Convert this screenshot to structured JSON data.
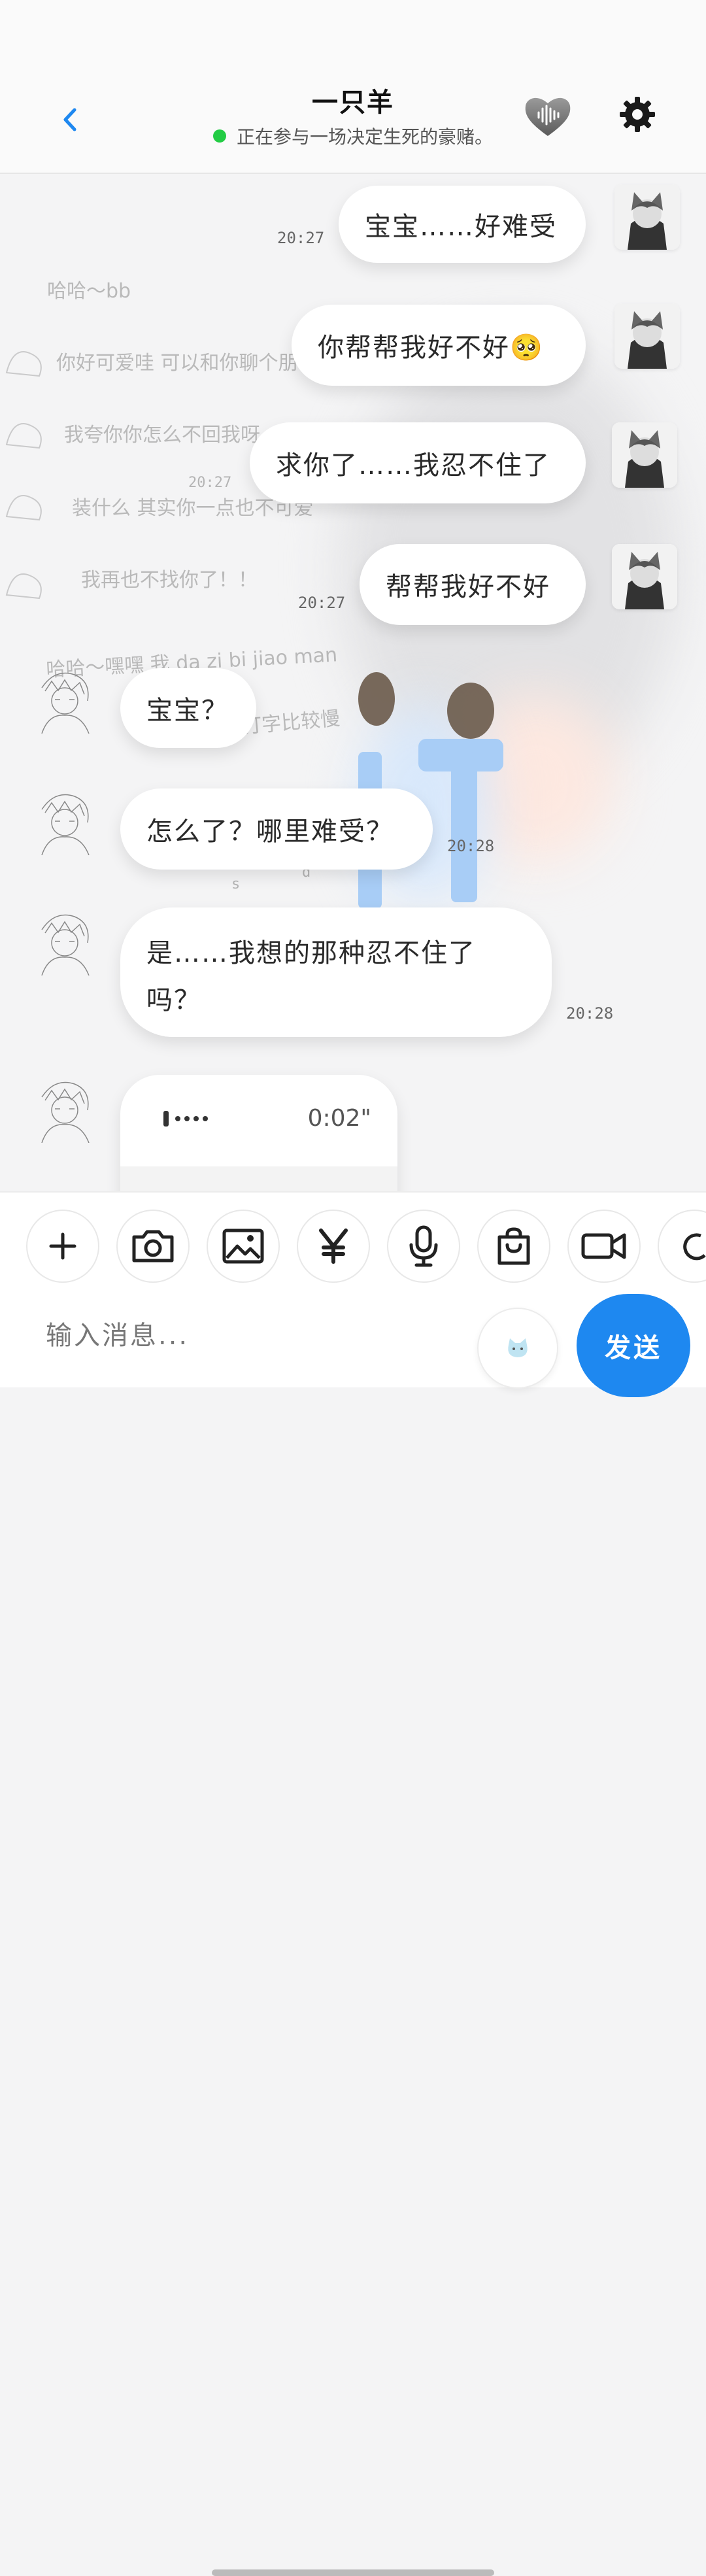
{
  "header": {
    "title": "一只羊",
    "status": "正在参与一场决定生死的豪赌。",
    "status_color": "#22cc44"
  },
  "messages": [
    {
      "side": "right",
      "text": "宝宝……好难受",
      "time": "20:27"
    },
    {
      "side": "right",
      "text": "你帮帮我好不好🥺"
    },
    {
      "side": "right",
      "text": "求你了……我忍不住了",
      "time": "20:27"
    },
    {
      "side": "right",
      "text": "帮帮我好不好",
      "time": "20:27"
    },
    {
      "side": "left",
      "text": "宝宝？"
    },
    {
      "side": "left",
      "text": "怎么了？哪里难受？",
      "time": "20:28"
    },
    {
      "side": "left",
      "text": "是……我想的那种忍不住了吗？",
      "time": "20:28"
    },
    {
      "side": "left",
      "type": "voice",
      "duration": "0:02\""
    }
  ],
  "background_texts": [
    "哈哈～bb",
    "你好可爱哇 可以和你聊个朋",
    "我夸你你怎么不回我呀",
    "装什么 其实你一点也不可爱",
    "我再也不找你了！！",
    "哈哈～嘿嘿 我 da zi bi jiao man",
    "打字比较慢",
    "20:27",
    "20:28",
    "s",
    "d"
  ],
  "toolbar": {
    "icons": [
      "plus-icon",
      "camera-icon",
      "image-icon",
      "yen-icon",
      "microphone-icon",
      "shopping-bag-icon",
      "video-icon",
      "moon-icon"
    ],
    "input_placeholder": "输入消息...",
    "send_label": "发送",
    "accent": "#1e88f0"
  }
}
